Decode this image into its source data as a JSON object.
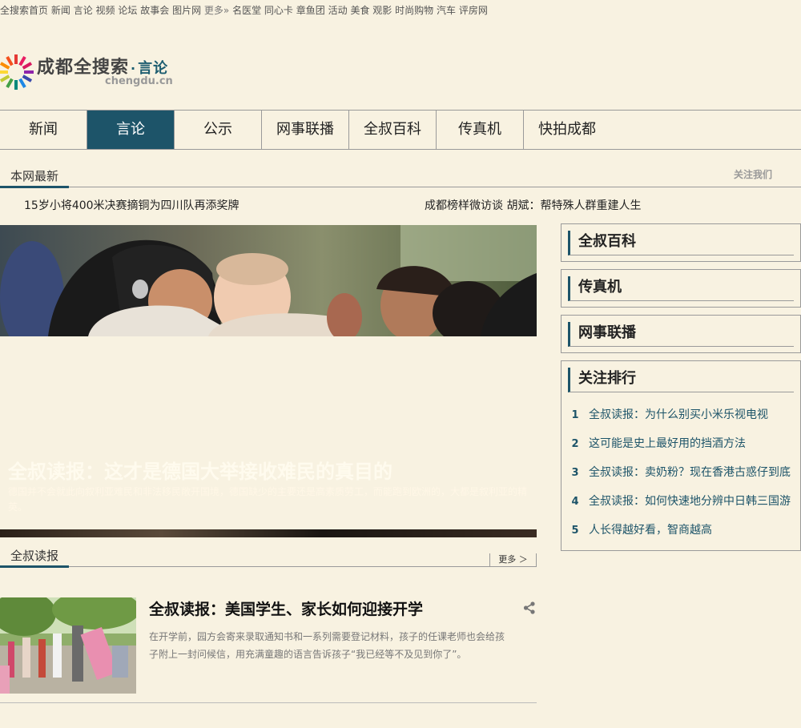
{
  "top_links": [
    "全搜索首页",
    "新闻",
    "言论",
    "视频",
    "论坛",
    "故事会",
    "图片网",
    "更多»",
    "名医堂",
    "同心卡",
    "章鱼团",
    "活动",
    "美食",
    "观影",
    "时尚购物",
    "汽车",
    "评房网"
  ],
  "logo": {
    "brand": "成都全搜索",
    "dot": "·",
    "section": "言论",
    "domain": "chengdu.cn"
  },
  "nav": [
    {
      "label": "新闻"
    },
    {
      "label": "言论",
      "active": true
    },
    {
      "label": "公示"
    },
    {
      "label": "网事联播"
    },
    {
      "label": "全叔百科"
    },
    {
      "label": "传真机"
    },
    {
      "label": "快拍成都"
    }
  ],
  "latest": {
    "label": "本网最新",
    "follow": "关注我们",
    "items": [
      "15岁小将400米决赛摘铜为四川队再添奖牌",
      "成都榜样微访谈 胡斌：帮特殊人群重建人生"
    ]
  },
  "hero": {
    "title": "全叔读报：这才是德国大举接收难民的真目的",
    "desc": "德国并不会就此向叙利亚难民和非法移民敞开国境，德国缺少的主要还是高素质劳工，而能跑到欧洲的，大都是叙利亚的精英。"
  },
  "sidebar": {
    "boxes": [
      "全叔百科",
      "传真机",
      "网事联播"
    ],
    "ranking": {
      "title": "关注排行",
      "items": [
        {
          "num": "1",
          "text": "全叔读报：为什么别买小米乐视电视"
        },
        {
          "num": "2",
          "text": "这可能是史上最好用的挡酒方法"
        },
        {
          "num": "3",
          "text": "全叔读报：卖奶粉？现在香港古惑仔到底"
        },
        {
          "num": "4",
          "text": "全叔读报：如何快速地分辨中日韩三国游"
        },
        {
          "num": "5",
          "text": "人长得越好看，智商越高"
        }
      ]
    }
  },
  "reading": {
    "label": "全叔读报",
    "more": "更多 ＞",
    "article": {
      "title": "全叔读报：美国学生、家长如何迎接开学",
      "desc": "在开学前，园方会寄来录取通知书和一系列需要登记材料，孩子的任课老师也会给孩子附上一封问候信，用充满童趣的语言告诉孩子“我已经等不及见到你了”。"
    }
  },
  "colors": {
    "background": "#f8f2e1",
    "accent": "#1d5469"
  },
  "icons": {
    "share": "share-icon",
    "logo": "color-wheel-logo-icon"
  }
}
